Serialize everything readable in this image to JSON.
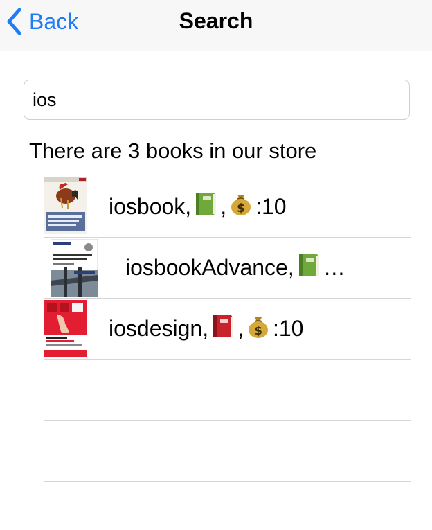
{
  "nav": {
    "back_label": "Back",
    "title": "Search"
  },
  "search": {
    "value": "ios"
  },
  "summary_text": "There are 3 books in our store",
  "books": [
    {
      "name": "iosbook,",
      "sep": ",",
      "price_label": ":10",
      "book_color": "green"
    },
    {
      "name": "iosbookAdvance,",
      "ellipsis": "…",
      "book_color": "green"
    },
    {
      "name": "iosdesign,",
      "sep": ",",
      "price_label": ":10",
      "book_color": "red"
    }
  ],
  "colors": {
    "accent": "#1f7cf6",
    "navbar_bg": "#f7f7f7",
    "separator": "#d6d6d6"
  },
  "icons": {
    "back": "chevron-left-icon",
    "green_book": "green-book-icon",
    "red_book": "red-book-icon",
    "money_bag": "money-bag-icon"
  }
}
